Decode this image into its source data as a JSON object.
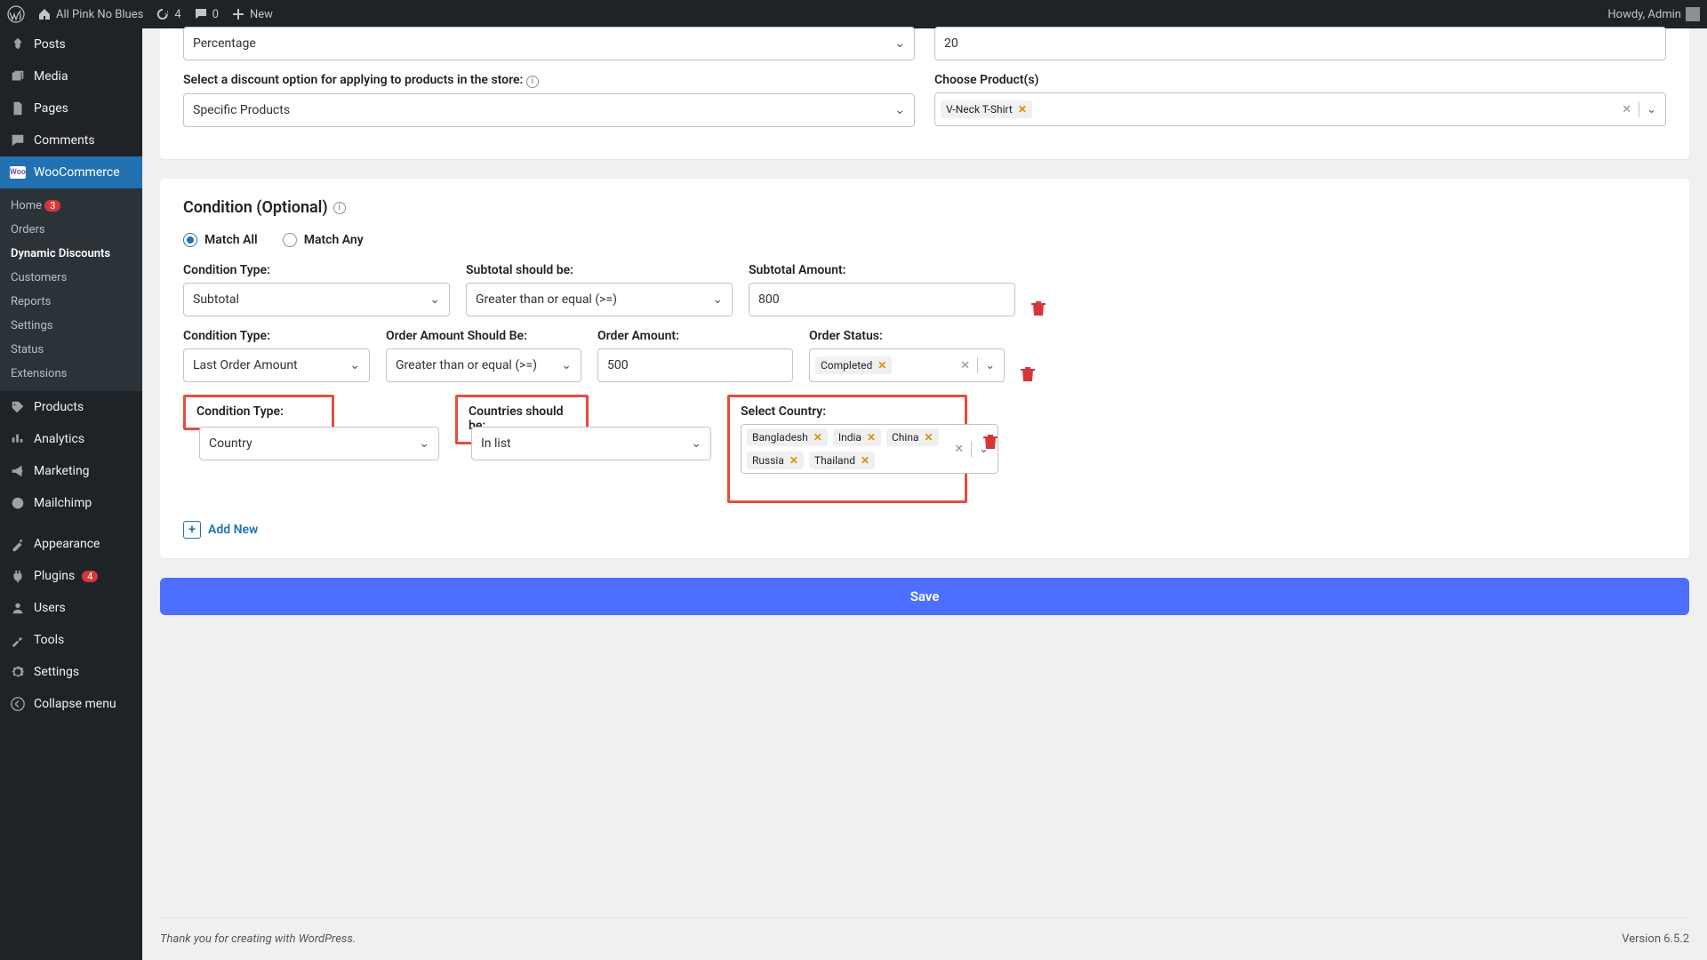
{
  "adminbar": {
    "site_name": "All Pink No Blues",
    "updates": "4",
    "comments": "0",
    "new_label": "New",
    "greeting": "Howdy, Admin"
  },
  "sidebar": {
    "posts": "Posts",
    "media": "Media",
    "pages": "Pages",
    "comments": "Comments",
    "woocommerce": "WooCommerce",
    "submenu": {
      "home": "Home",
      "home_badge": "3",
      "orders": "Orders",
      "dynamic": "Dynamic Discounts",
      "customers": "Customers",
      "reports": "Reports",
      "settings": "Settings",
      "status": "Status",
      "extensions": "Extensions"
    },
    "products": "Products",
    "analytics": "Analytics",
    "marketing": "Marketing",
    "mailchimp": "Mailchimp",
    "appearance": "Appearance",
    "plugins": "Plugins",
    "plugins_badge": "4",
    "users": "Users",
    "tools": "Tools",
    "settings_main": "Settings",
    "collapse": "Collapse menu"
  },
  "top": {
    "percentage": "Percentage",
    "percentage_value": "20",
    "discount_option_label": "Select a discount option for applying to products in the store:",
    "discount_option_value": "Specific Products",
    "choose_products_label": "Choose Product(s)",
    "product_tag": "V-Neck T-Shirt"
  },
  "condition": {
    "title": "Condition (Optional)",
    "match_all": "Match All",
    "match_any": "Match Any",
    "row1": {
      "type_label": "Condition Type:",
      "type_value": "Subtotal",
      "operator_label": "Subtotal should be:",
      "operator_value": "Greater than or equal (>=)",
      "amount_label": "Subtotal Amount:",
      "amount_value": "800"
    },
    "row2": {
      "type_label": "Condition Type:",
      "type_value": "Last Order Amount",
      "operator_label": "Order Amount Should Be:",
      "operator_value": "Greater than or equal (>=)",
      "amount_label": "Order Amount:",
      "amount_value": "500",
      "status_label": "Order Status:",
      "status_tag": "Completed"
    },
    "row3": {
      "type_label": "Condition Type:",
      "type_value": "Country",
      "operator_label": "Countries should be:",
      "operator_value": "In list",
      "select_label": "Select Country:",
      "c1": "Bangladesh",
      "c2": "India",
      "c3": "China",
      "c4": "Russia",
      "c5": "Thailand"
    },
    "add_new": "Add New"
  },
  "save_label": "Save",
  "footer": {
    "thanks": "Thank you for creating with WordPress.",
    "version": "Version 6.5.2"
  }
}
